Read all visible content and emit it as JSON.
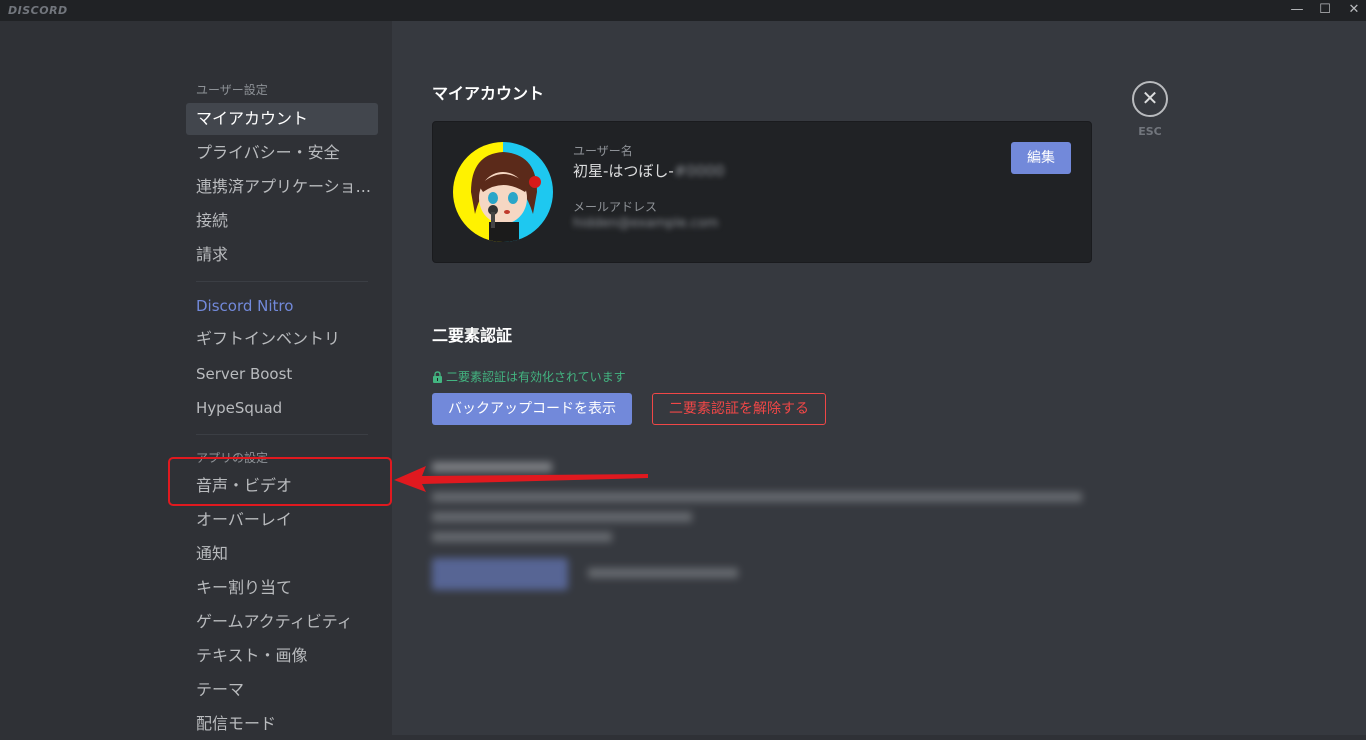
{
  "titlebar": {
    "logo": "DISCORD",
    "minimize": "—",
    "maximize": "☐",
    "close": "✕"
  },
  "sidebar": {
    "user_settings_header": "ユーザー設定",
    "user_items": [
      "マイアカウント",
      "プライバシー・安全",
      "連携済アプリケーショ...",
      "接続",
      "請求"
    ],
    "nitro_label": "Discord Nitro",
    "nitro_items": [
      "ギフトインベントリ",
      "Server Boost",
      "HypeSquad"
    ],
    "app_settings_header": "アプリの設定",
    "app_items": [
      "音声・ビデオ",
      "オーバーレイ",
      "通知",
      "キー割り当て",
      "ゲームアクティビティ",
      "テキスト・画像",
      "テーマ",
      "配信モード"
    ]
  },
  "account": {
    "title": "マイアカウント",
    "username_label": "ユーザー名",
    "username_value": "初星-はつぼし-",
    "username_tag": "#0000",
    "email_label": "メールアドレス",
    "email_value": "hidden@example.com",
    "edit_button": "編集"
  },
  "esc": {
    "icon": "✕",
    "label": "ESC"
  },
  "two_factor": {
    "title": "二要素認証",
    "status": "二要素認証は有効化されています",
    "backup_button": "バックアップコードを表示",
    "disable_button": "二要素認証を解除する"
  },
  "colors": {
    "accent": "#7289da",
    "danger": "#f04747",
    "success": "#43b581",
    "highlight": "#e0191f"
  }
}
